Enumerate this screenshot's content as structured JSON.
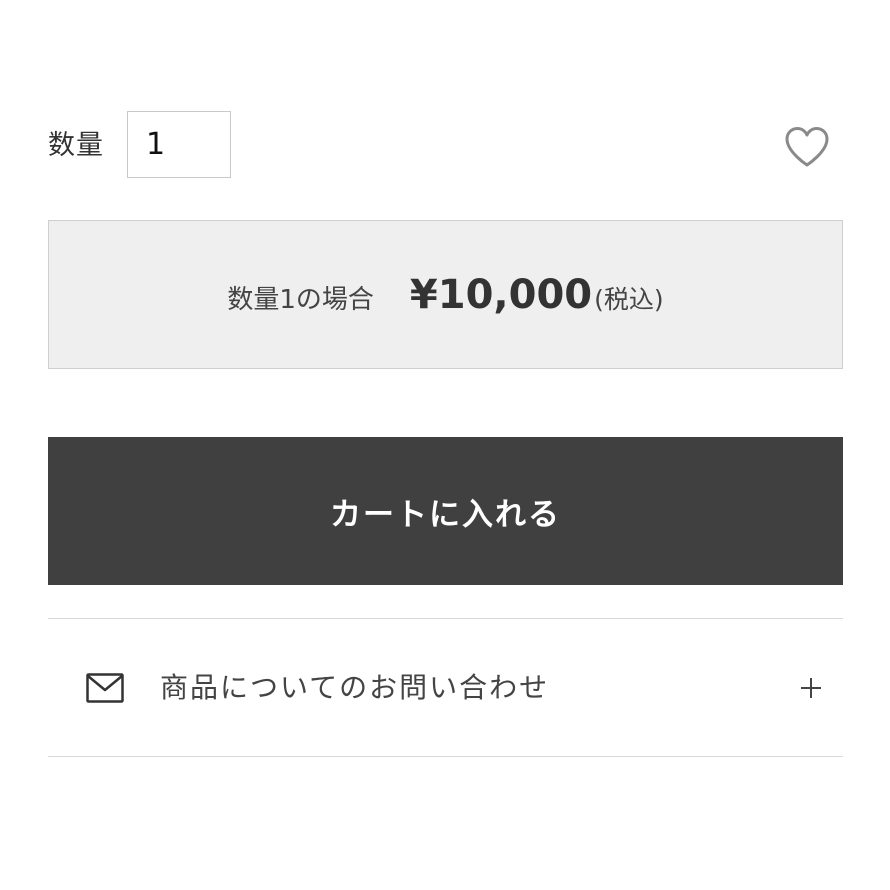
{
  "quantity": {
    "label": "数量",
    "value": "1"
  },
  "favorite": {
    "icon": "heart-outline-icon"
  },
  "price": {
    "condition": "数量1の場合",
    "amount": "¥10,000",
    "tax_note": "(税込)"
  },
  "cart": {
    "button_label": "カートに入れる"
  },
  "inquiry": {
    "icon": "mail-icon",
    "label": "商品についてのお問い合わせ",
    "toggle_icon": "plus-icon"
  },
  "colors": {
    "cart_button_bg": "#404040",
    "price_box_bg": "#efefef",
    "text": "#333333"
  }
}
